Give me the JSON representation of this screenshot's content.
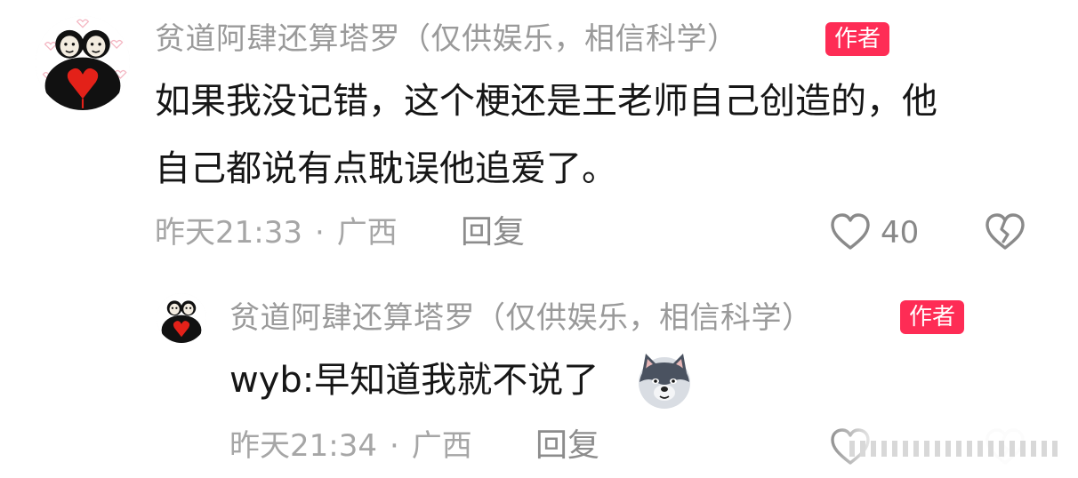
{
  "colors": {
    "author_badge_bg": "#fe2c55",
    "username": "#9a9a9a",
    "content_text": "#161616",
    "meta_text": "#a6a6a6"
  },
  "comment": {
    "username": "贫道阿肆还算塔罗（仅供娱乐，相信科学）",
    "badge": "作者",
    "content_line1": "如果我没记错，这个梗还是王老师自己创造的，他",
    "content_line2": "自己都说有点耽误他追爱了。",
    "time": "昨天21:33",
    "location": "广西",
    "reply_label": "回复",
    "like_count": "40",
    "like_icon": "heart-outline-icon",
    "dislike_icon": "broken-heart-icon"
  },
  "reply": {
    "username": "贫道阿肆还算塔罗（仅供娱乐，相信科学）",
    "badge": "作者",
    "content": "wyb:早知道我就不说了",
    "emoji_icon": "wolf-emoji-icon",
    "time": "昨天21:34",
    "location": "广西",
    "reply_label": "回复"
  }
}
